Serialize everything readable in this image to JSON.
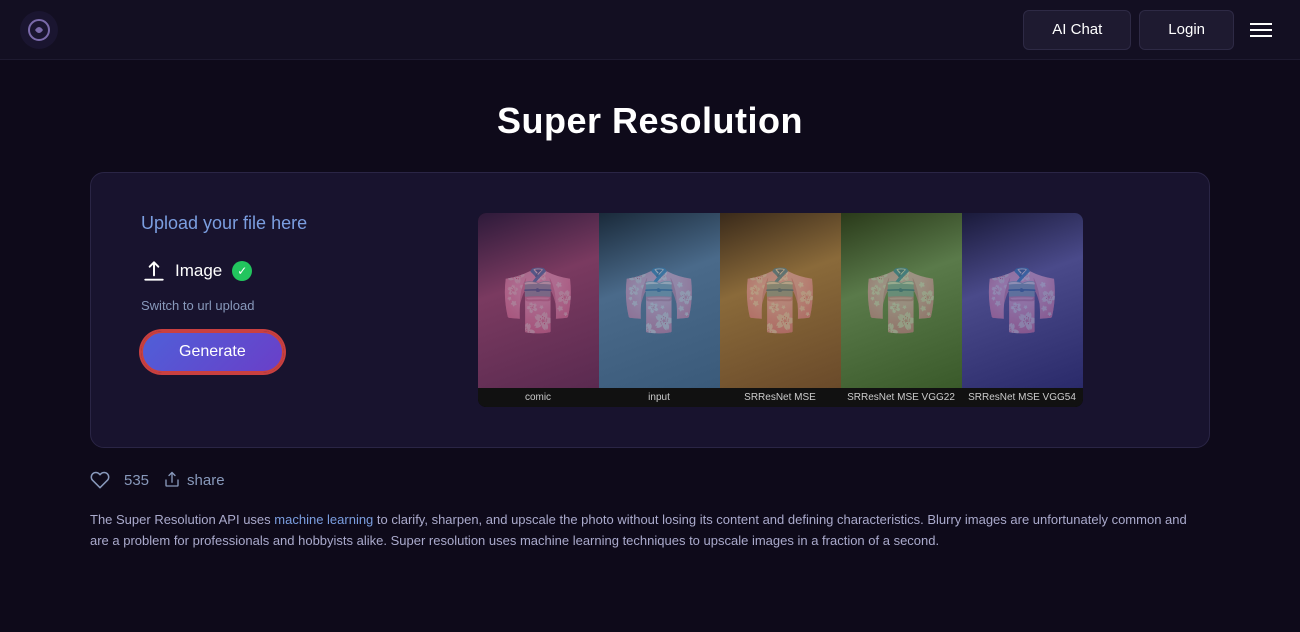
{
  "navbar": {
    "logo_unicode": "◕",
    "ai_chat_label": "AI Chat",
    "login_label": "Login"
  },
  "page": {
    "title": "Super Resolution"
  },
  "upload_panel": {
    "upload_label": "Upload your file here",
    "image_label": "Image",
    "switch_url_label": "Switch to url upload",
    "generate_label": "Generate"
  },
  "image_strip": {
    "labels": [
      "comic",
      "input",
      "SRResNet MSE",
      "SRResNet MSE VGG22",
      "SRResNet MSE VGG54"
    ]
  },
  "social": {
    "like_count": "535",
    "share_label": "share"
  },
  "description": {
    "prefix": "The Super Resolution API uses ",
    "link_text": "machine learning",
    "suffix": " to clarify, sharpen, and upscale the photo without losing its content and defining characteristics. Blurry images are unfortunately common and are a problem for professionals and hobbyists alike. Super resolution uses machine learning techniques to upscale images in a fraction of a second."
  }
}
